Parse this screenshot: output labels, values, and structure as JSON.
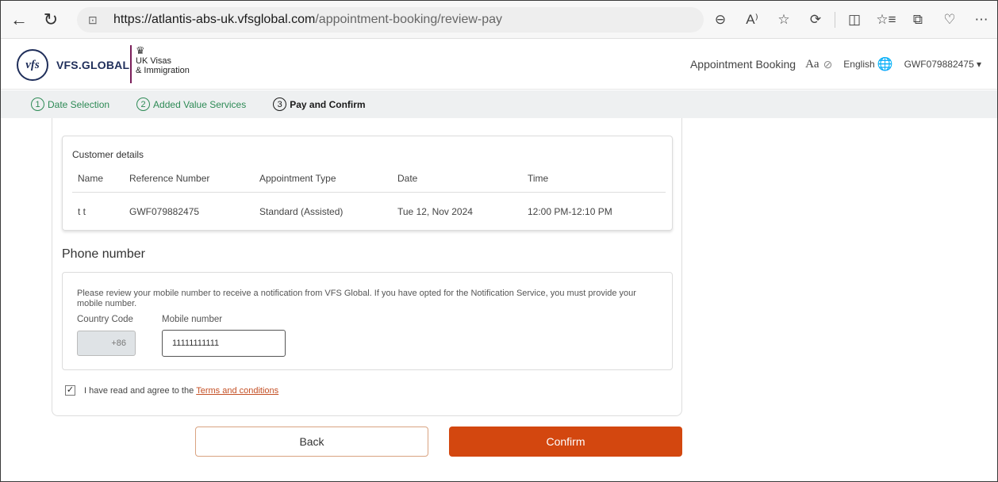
{
  "browser": {
    "url_host": "https://atlantis-abs-uk.vfsglobal.com",
    "url_path": "/appointment-booking/review-pay",
    "icons": [
      "back-arrow-icon",
      "refresh-icon",
      "lock-icon",
      "zoom-out-icon",
      "read-aloud-icon",
      "favorite-star-icon",
      "extensions-icon",
      "split-screen-icon",
      "favorites-list-icon",
      "collections-icon",
      "browser-essentials-icon",
      "more-menu-icon"
    ]
  },
  "header": {
    "logo_text": "vfs",
    "brand": "VFS.GLOBAL",
    "ukvi_line1": "UK Visas",
    "ukvi_line2": "& Immigration",
    "appointment_booking": "Appointment Booking",
    "text_size": "Aa",
    "language": "English",
    "user_id": "GWF079882475 ▾"
  },
  "stepper": {
    "steps": [
      {
        "num": "1",
        "label": "Date Selection"
      },
      {
        "num": "2",
        "label": "Added Value Services"
      },
      {
        "num": "3",
        "label": "Pay and Confirm"
      }
    ]
  },
  "customer": {
    "title": "Customer details",
    "headers": [
      "Name",
      "Reference Number",
      "Appointment Type",
      "Date",
      "Time"
    ],
    "row": [
      "t t",
      "GWF079882475",
      "Standard (Assisted)",
      "Tue 12, Nov 2024",
      "12:00 PM-12:10 PM"
    ]
  },
  "phone": {
    "title": "Phone number",
    "note": "Please review your mobile number to receive a notification from VFS Global. If you have opted for the Notification Service, you must provide your mobile number.",
    "country_code_label": "Country Code",
    "country_code_value": "+86",
    "mobile_label": "Mobile number",
    "mobile_value": "11111111111"
  },
  "agree": {
    "checked": "✓",
    "text": "I have read and agree to the",
    "link": "Terms and conditions"
  },
  "actions": {
    "back": "Back",
    "confirm": "Confirm"
  },
  "colors": {
    "accent": "#d3470f",
    "step_done": "#2d8a55",
    "brand_navy": "#1f2e5a"
  }
}
